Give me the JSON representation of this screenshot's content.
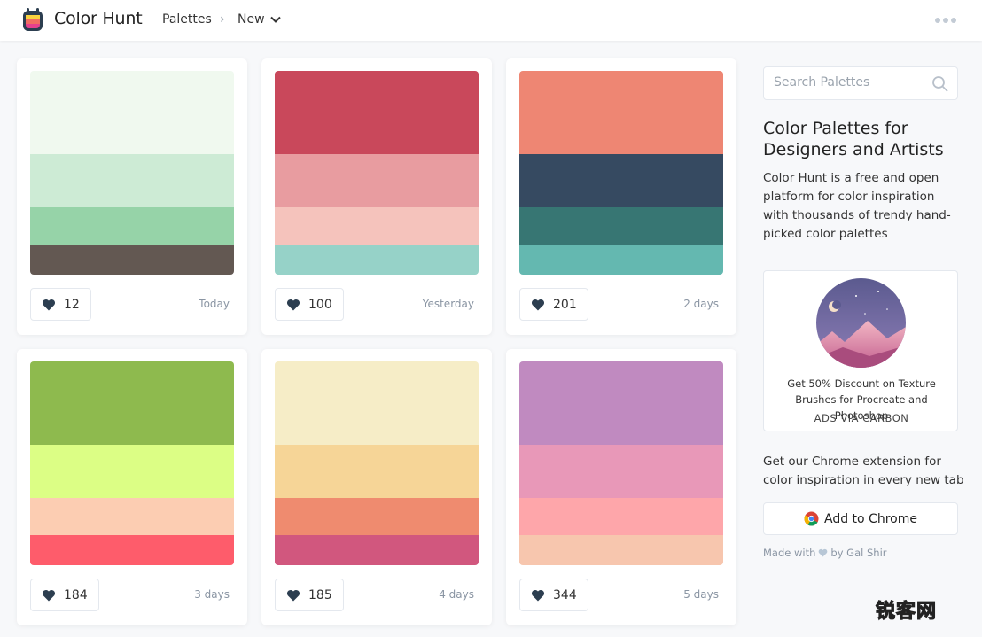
{
  "header": {
    "brand": "Color Hunt",
    "nav_palettes": "Palettes",
    "nav_separator": "›",
    "nav_new": "New"
  },
  "cards": [
    {
      "colors": [
        "#f0f9ef",
        "#cdebd5",
        "#96d3a8",
        "#635852"
      ],
      "likes": "12",
      "date": "Today"
    },
    {
      "colors": [
        "#c9485b",
        "#e89ca0",
        "#f5c3bc",
        "#96d2c8"
      ],
      "likes": "100",
      "date": "Yesterday"
    },
    {
      "colors": [
        "#ee8673",
        "#364a61",
        "#377673",
        "#64b8b0"
      ],
      "likes": "201",
      "date": "2 days"
    },
    {
      "colors": [
        "#8eba4e",
        "#dcfe85",
        "#fccdb2",
        "#fe5c6b"
      ],
      "likes": "184",
      "date": "3 days"
    },
    {
      "colors": [
        "#f6edc7",
        "#f6d597",
        "#ef8b6f",
        "#d1577e"
      ],
      "likes": "185",
      "date": "4 days"
    },
    {
      "colors": [
        "#c08ac0",
        "#e898b8",
        "#fea6aa",
        "#f7c6ae"
      ],
      "likes": "344",
      "date": "5 days"
    }
  ],
  "sidebar": {
    "search_placeholder": "Search Palettes",
    "title": "Color Palettes for Designers and Artists",
    "description": "Color Hunt is a free and open platform for color inspiration with thousands of trendy hand-picked color palettes",
    "ad": {
      "text": "Get 50% Discount on Texture Brushes for Procreate and Photoshop",
      "via": "ADS VIA CARBON"
    },
    "extension_text": "Get our Chrome extension for color inspiration in every new tab",
    "chrome_button": "Add to Chrome",
    "made_prefix": "Made with",
    "made_suffix": "by Gal Shir"
  },
  "watermark": "锐客网",
  "colors": {
    "accent_heart": "#2c3e50",
    "muted_text": "#8a95a3",
    "border": "#e4e8ee"
  }
}
